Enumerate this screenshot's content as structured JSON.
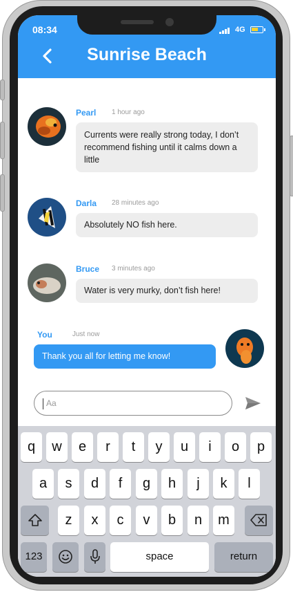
{
  "status_bar": {
    "time": "08:34",
    "network": "4G"
  },
  "header": {
    "title": "Sunrise Beach"
  },
  "messages": [
    {
      "name": "Pearl",
      "time": "1 hour ago",
      "text": "Currents were really strong today, I don’t recommend fishing until it calms down a little"
    },
    {
      "name": "Darla",
      "time": "28 minutes ago",
      "text": "Absolutely NO fish here."
    },
    {
      "name": "Bruce",
      "time": "3 minutes ago",
      "text": "Water is very murky, don’t fish here!"
    },
    {
      "name": "You",
      "time": "Just now",
      "text": "Thank you all for letting me know!"
    }
  ],
  "composer": {
    "placeholder": "Aa"
  },
  "keyboard": {
    "row1": [
      "q",
      "w",
      "e",
      "r",
      "t",
      "y",
      "u",
      "i",
      "o",
      "p"
    ],
    "row2": [
      "a",
      "s",
      "d",
      "f",
      "g",
      "h",
      "j",
      "k",
      "l"
    ],
    "row3": [
      "z",
      "x",
      "c",
      "v",
      "b",
      "n",
      "m"
    ],
    "numbers_label": "123",
    "space_label": "space",
    "return_label": "return"
  },
  "colors": {
    "accent": "#3399f3",
    "bubble": "#ededed",
    "keyboard_bg": "#d1d3d9"
  },
  "icons": [
    "back-chevron-icon",
    "send-icon",
    "shift-icon",
    "backspace-icon",
    "emoji-icon",
    "microphone-icon"
  ]
}
